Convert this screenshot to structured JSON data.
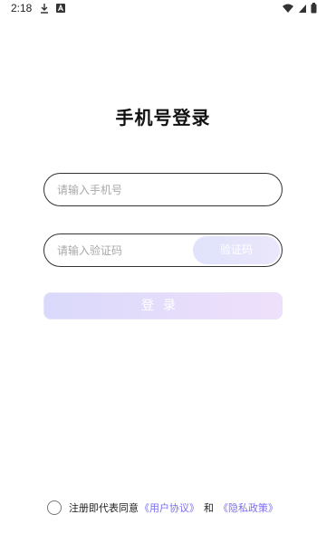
{
  "status_bar": {
    "time": "2:18",
    "left_icons": [
      "download-icon",
      "a-box-icon"
    ],
    "right_icons": [
      "wifi-icon",
      "signal-icon",
      "battery-icon"
    ]
  },
  "page": {
    "title": "手机号登录"
  },
  "phone": {
    "placeholder": "请输入手机号",
    "value": ""
  },
  "code": {
    "placeholder": "请输入验证码",
    "value": "",
    "button_label": "验证码"
  },
  "login": {
    "label": "登录"
  },
  "agreement": {
    "prefix": "注册即代表同意",
    "user_agreement": "《用户协议》",
    "and": "和",
    "privacy_policy": "《隐私政策》",
    "checked": false
  },
  "colors": {
    "accent_link": "#7b6ef0",
    "button_gradient_start": "#dad9fb",
    "button_gradient_end": "#efe0fb"
  }
}
